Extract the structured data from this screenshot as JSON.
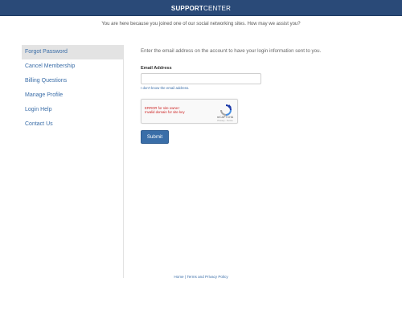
{
  "header": {
    "logo_bold": "SUPPORT",
    "logo_regular": "CENTER"
  },
  "tagline": "You are here because you joined one of our social networking sites. How may we assist you?",
  "sidebar": {
    "items": [
      {
        "label": "Forgot Password",
        "active": true
      },
      {
        "label": "Cancel Membership",
        "active": false
      },
      {
        "label": "Billing Questions",
        "active": false
      },
      {
        "label": "Manage Profile",
        "active": false
      },
      {
        "label": "Login Help",
        "active": false
      },
      {
        "label": "Contact Us",
        "active": false
      }
    ]
  },
  "main": {
    "intro": "Enter the email address on the account to have your login information sent to you.",
    "email_label": "Email Address",
    "email_value": "",
    "forgot_email_link": "I don't know the email address.",
    "captcha": {
      "error_line1": "ERROR for site owner:",
      "error_line2": "Invalid domain for site key",
      "brand": "reCAPTCHA",
      "terms": "Privacy - Terms"
    },
    "submit_label": "Submit"
  },
  "footer": {
    "home": "Home",
    "separator": "|",
    "terms": "Terms and Privacy Policy"
  },
  "colors": {
    "header_bg": "#2a4a78",
    "link": "#3b6ea8",
    "button": "#3a6ea8",
    "error": "#cc2222"
  }
}
